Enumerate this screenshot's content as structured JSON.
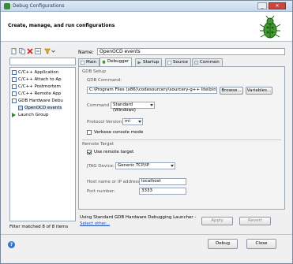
{
  "window": {
    "title": "Debug Configurations",
    "subtitle": "Create, manage, and run configurations"
  },
  "left_panel": {
    "filter_placeholder": "",
    "tree": [
      {
        "label": "C/C++ Application",
        "indent": 1
      },
      {
        "label": "C/C++ Attach to Ap",
        "indent": 1
      },
      {
        "label": "C/C++ Postmortem",
        "indent": 1
      },
      {
        "label": "C/C++ Remote App",
        "indent": 1
      },
      {
        "label": "GDB Hardware Debu",
        "indent": 1
      },
      {
        "label": "OpenOCD events",
        "indent": 2
      },
      {
        "label": "Launch Group",
        "indent": 1
      }
    ],
    "filter_status": "Filter matched 8 of 8 items"
  },
  "right_panel": {
    "name_label": "Name:",
    "name_value": "OpenOCD events",
    "tabs": [
      "Main",
      "Debugger",
      "Startup",
      "Source",
      "Common"
    ],
    "active_tab": "Debugger",
    "gdb_setup": {
      "section_label": "GDB Setup",
      "command_label": "GDB Command:",
      "command_value": "C:\\Program Files (x86)\\codesourcery\\sourcery-g++ lite\\bin\\arm-none-eabi-gdb.exe",
      "browse_label": "Browse...",
      "variables_label": "Variables...",
      "command_set_label": "Command Set:",
      "command_set_value": "Standard (Windows)",
      "protocol_label": "Protocol Version:",
      "protocol_value": "mi",
      "verbose_label": "Verbose console mode",
      "verbose_checked": false
    },
    "remote_target": {
      "section_label": "Remote Target",
      "use_remote_label": "Use remote target",
      "use_remote_checked": true,
      "jtag_label": "JTAG Device:",
      "jtag_value": "Generic TCP/IP",
      "host_label": "Host name or IP address:",
      "host_value": "localhost",
      "port_label": "Port number:",
      "port_value": "3333"
    },
    "apply_label": "Apply",
    "revert_label": "Revert",
    "launcher_text": "Using Standard GDB Hardware Debugging Launcher -",
    "select_other_label": "Select other..."
  },
  "buttons": {
    "debug_label": "Debug",
    "close_label": "Close"
  },
  "colors": {
    "accent": "#3a74c4",
    "link": "#1a4bb8"
  }
}
